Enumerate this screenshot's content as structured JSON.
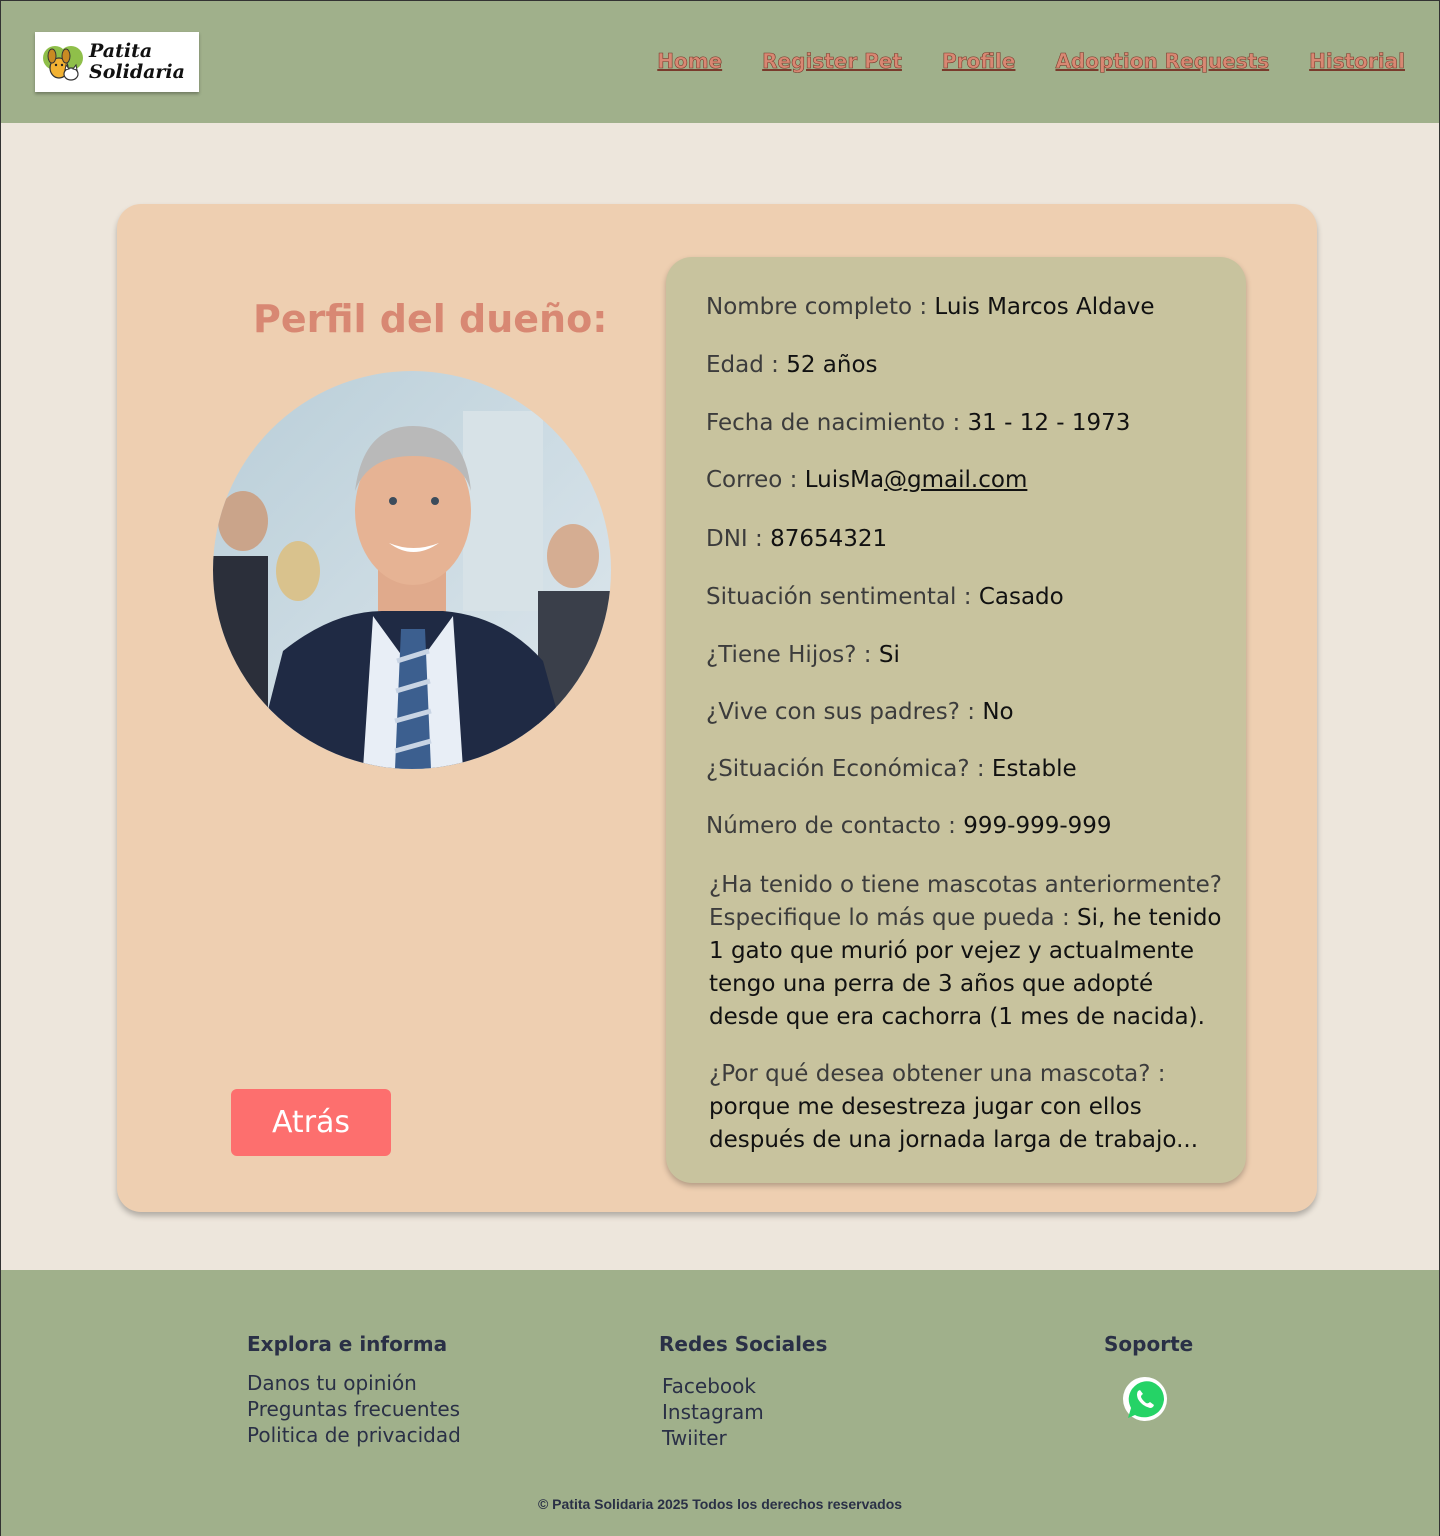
{
  "brand": {
    "name": "Patita\nSolidaria"
  },
  "nav": [
    {
      "label": "Home"
    },
    {
      "label": "Register Pet"
    },
    {
      "label": "Profile"
    },
    {
      "label": "Adoption Requests"
    },
    {
      "label": "Historial"
    }
  ],
  "profile": {
    "title": "Perfil del dueño:",
    "back_label": "Atrás",
    "fields": [
      {
        "label": "Nombre completo :",
        "value": "Luis Marcos Aldave"
      },
      {
        "label": "Edad :",
        "value": "52 años"
      },
      {
        "label": "Fecha de nacimiento :",
        "value": "31 - 12 - 1973"
      },
      {
        "label": "Correo :",
        "value_a": "LuisMa",
        "value_b": "@gmail.com"
      },
      {
        "label": "DNI :",
        "value": "87654321"
      },
      {
        "label": "Situación sentimental :",
        "value": "Casado"
      },
      {
        "label": "¿Tiene Hijos? :",
        "value": "Si"
      },
      {
        "label": "¿Vive con sus padres? :",
        "value": "No"
      },
      {
        "label": "¿Situación Económica? :",
        "value": "Estable"
      },
      {
        "label": "Número de contacto :",
        "value": "999-999-999"
      }
    ],
    "pets_history": {
      "label": "¿Ha tenido o tiene mascotas anteriormente? Especifique lo más que pueda :",
      "value": "Si, he tenido 1 gato que murió por vejez y actualmente tengo una perra de 3 años que adopté desde que era cachorra (1 mes de nacida)."
    },
    "reason": {
      "label": "¿Por qué desea obtener una mascota? :",
      "value": "porque me desestreza jugar con ellos después de una jornada larga de trabajo..."
    }
  },
  "footer": {
    "explore": {
      "title": "Explora e informa",
      "links": [
        "Danos tu opinión",
        "Preguntas frecuentes",
        "Politica de privacidad"
      ]
    },
    "social": {
      "title": "Redes Sociales",
      "links": [
        "Facebook",
        "Instagram",
        "Twiiter"
      ]
    },
    "support": {
      "title": "Soporte",
      "icon": "whatsapp-icon"
    },
    "copyright": "© Patita Solidaria 2025 Todos los derechos reservados"
  },
  "colors": {
    "header": "#a0b08b",
    "background": "#ede6dc",
    "card": "#eecfb1",
    "info_box": "#c8c39e",
    "accent": "#d88873",
    "button": "#fd6f6e"
  }
}
